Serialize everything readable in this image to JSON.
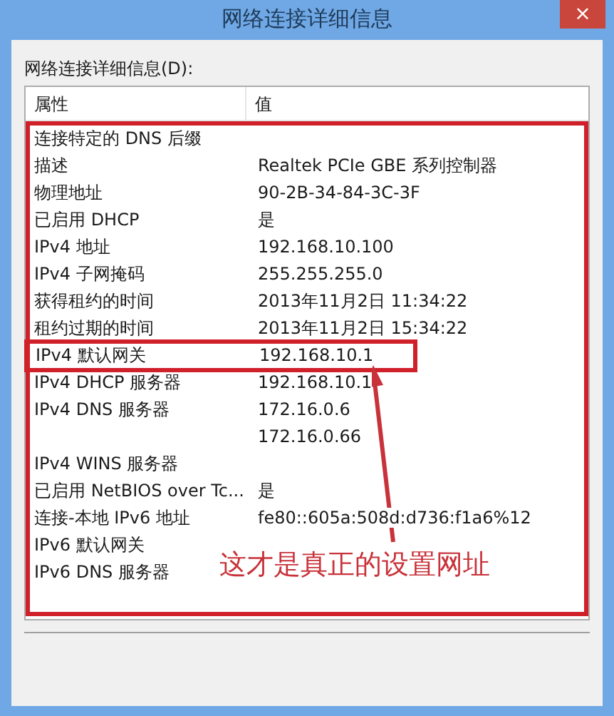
{
  "window": {
    "title": "网络连接详细信息",
    "close": "×"
  },
  "label": "网络连接详细信息(D):",
  "table": {
    "columns": [
      "属性",
      "值"
    ],
    "rows": [
      {
        "property": "连接特定的 DNS 后缀",
        "highlighted": false
      },
      {
        "property": "描述",
        "value": "Realtek PCIe GBE 系列控制器",
        "highlighted": false
      },
      {
        "property": "物理地址",
        "value": "90-2B-34-84-3C-3F",
        "highlighted": false
      },
      {
        "property": "已启用 DHCP",
        "value": "是",
        "highlighted": false
      },
      {
        "property": "IPv4 地址",
        "value": "192.168.10.100",
        "highlighted": false
      },
      {
        "property": "IPv4 子网掩码",
        "value": "255.255.255.0",
        "highlighted": false
      },
      {
        "property": "获得租约的时间",
        "value": "2013年11月2日 11:34:22",
        "highlighted": false
      },
      {
        "property": "租约过期的时间",
        "value": "2013年11月2日 15:34:22",
        "highlighted": false
      },
      {
        "property": "IPv4 默认网关",
        "value": "192.168.10.1",
        "highlighted": true
      },
      {
        "property": "IPv4 DHCP 服务器",
        "value": "192.168.10.1",
        "highlighted": false
      },
      {
        "property": "IPv4 DNS 服务器",
        "value": "172.16.0.6",
        "highlighted": false
      },
      {
        "value": "172.16.0.66",
        "highlighted": false
      },
      {
        "property": "IPv4 WINS 服务器",
        "highlighted": false
      },
      {
        "property": "已启用 NetBIOS over Tc...",
        "value": "是",
        "highlighted": false
      },
      {
        "property": "连接-本地 IPv6 地址",
        "value": "fe80::605a:508d:d736:f1a6%12",
        "highlighted": false
      },
      {
        "property": "IPv6 默认网关",
        "highlighted": false
      },
      {
        "property": "IPv6 DNS 服务器",
        "highlighted": false
      }
    ]
  },
  "annotation": {
    "text": "这才是真正的设置网址",
    "frame": true
  }
}
